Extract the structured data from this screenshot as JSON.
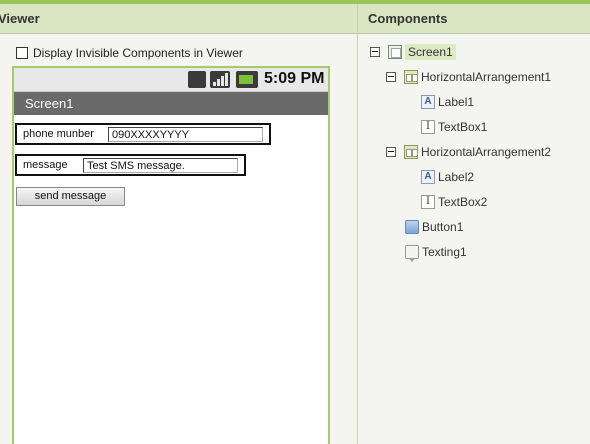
{
  "viewer": {
    "header": "Viewer",
    "display_invisible_label": "Display Invisible Components in Viewer"
  },
  "phone": {
    "status_time": "5:09 PM",
    "screen_title": "Screen1",
    "arrangement1": {
      "label": "phone munber",
      "textbox": "090XXXXYYYY"
    },
    "arrangement2": {
      "label": "message",
      "textbox": "Test SMS message."
    },
    "button": "send message"
  },
  "components": {
    "header": "Components",
    "tree": [
      {
        "name": "Screen1",
        "icon": "screen-icon"
      },
      {
        "name": "HorizontalArrangement1",
        "icon": "horizontal-arrangement-icon"
      },
      {
        "name": "Label1",
        "icon": "label-icon"
      },
      {
        "name": "TextBox1",
        "icon": "textbox-icon"
      },
      {
        "name": "HorizontalArrangement2",
        "icon": "horizontal-arrangement-icon"
      },
      {
        "name": "Label2",
        "icon": "label-icon"
      },
      {
        "name": "TextBox2",
        "icon": "textbox-icon"
      },
      {
        "name": "Button1",
        "icon": "button-icon"
      },
      {
        "name": "Texting1",
        "icon": "texting-icon"
      }
    ]
  },
  "colors": {
    "accent": "#9cc55a",
    "header_bg": "#d9e6c3",
    "title_bar": "#6a6a6a"
  }
}
